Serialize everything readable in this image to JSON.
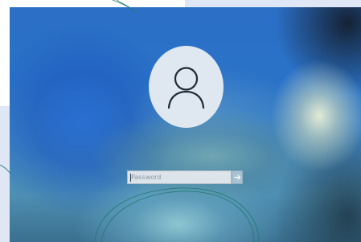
{
  "lock_screen": {
    "avatar_icon": "user-icon",
    "password_placeholder": "Password",
    "submit_icon": "arrow-right-icon"
  },
  "colors": {
    "screen_blue": "#2a72c8",
    "avatar_bg": "#dfe8f0",
    "icon_stroke": "#1f2a36",
    "field_bg": "#e8ecf0",
    "overlay_line": "#1f7a6e"
  }
}
